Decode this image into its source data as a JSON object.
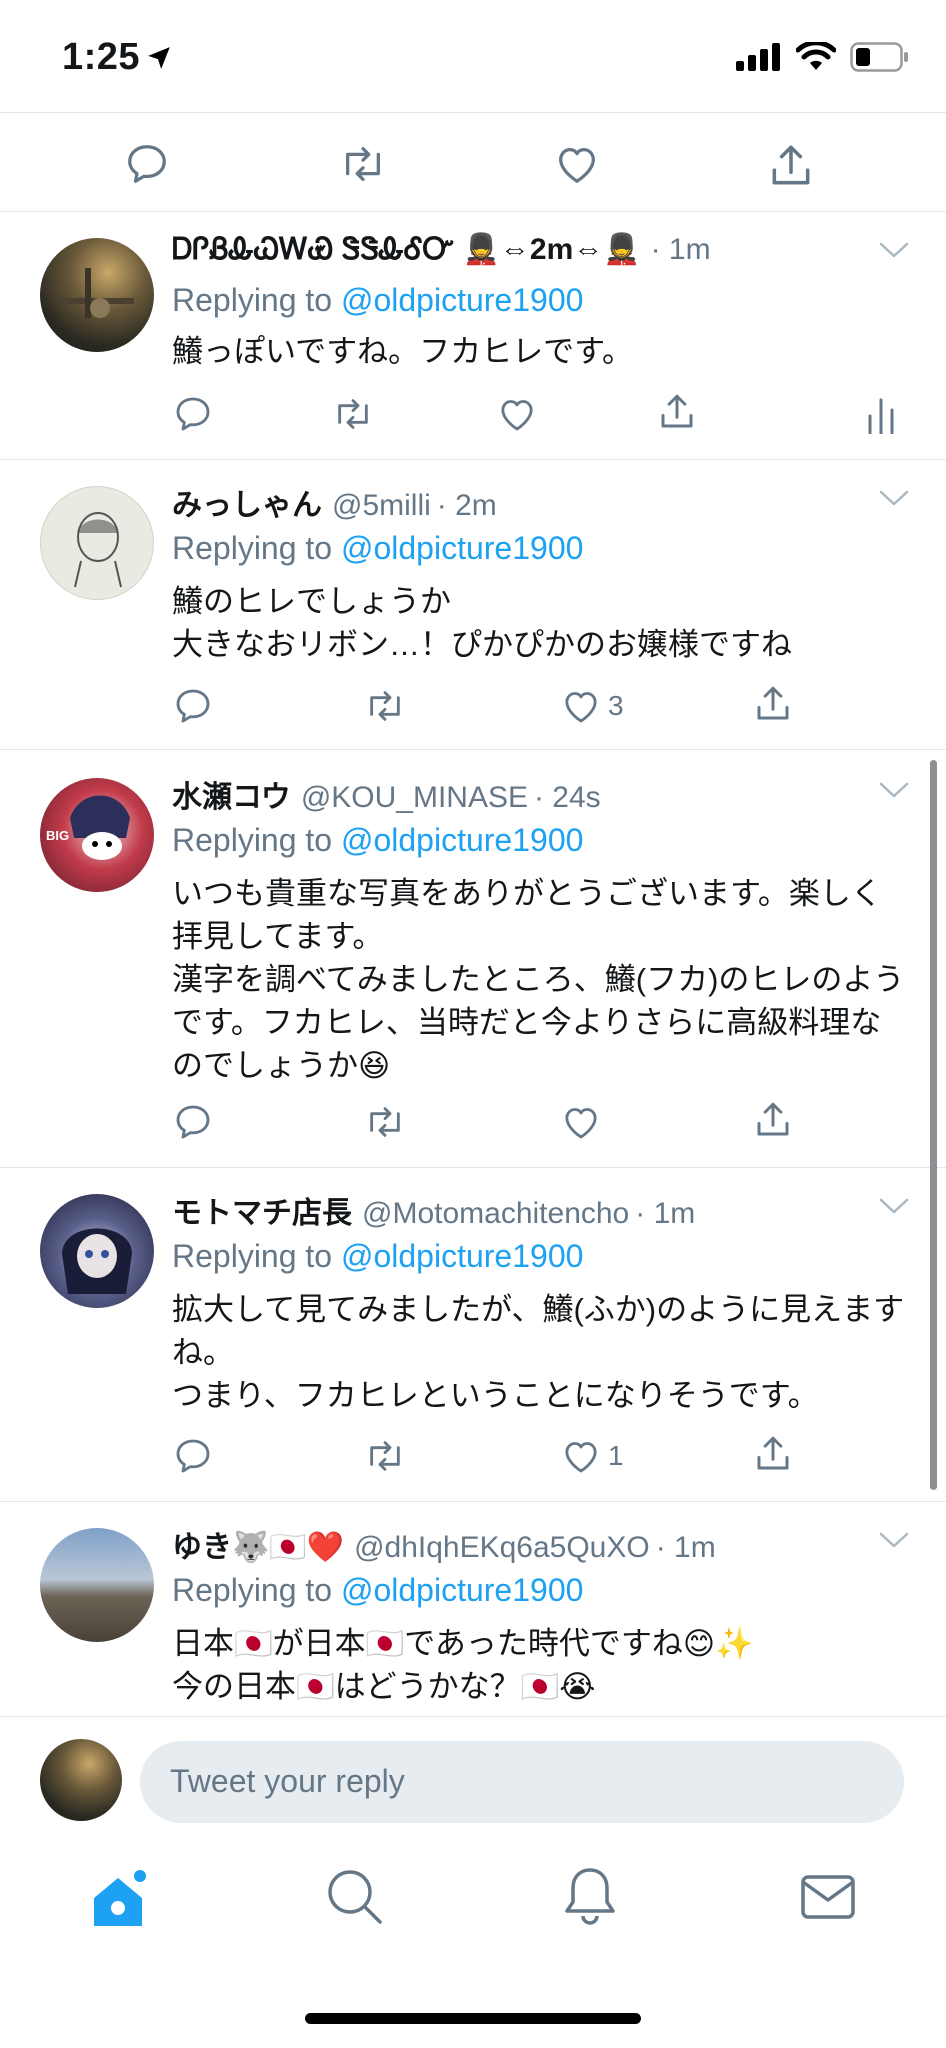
{
  "status_bar": {
    "time": "1:25"
  },
  "tweets": [
    {
      "name": "ᎠᎵᏰᎲᏇᎳᏯ ᏕᏕᎲᎴᏅ 💂⇔2m⇔💂",
      "handle": "",
      "time": "· 1m",
      "replying_label": "Replying to ",
      "replying_to": "@oldpicture1900",
      "lines": [
        "鱶っぽいですね。フカヒレです。"
      ],
      "likes": ""
    },
    {
      "name": "みっしゃん",
      "handle": "@5milli",
      "time": "· 2m",
      "replying_label": "Replying to ",
      "replying_to": "@oldpicture1900",
      "lines": [
        "鱶のヒレでしょうか",
        "大きなおリボン…！ぴかぴかのお嬢様ですね"
      ],
      "likes": "3"
    },
    {
      "name": "水瀬コウ",
      "handle": "@KOU_MINASE",
      "time": "· 24s",
      "replying_label": "Replying to ",
      "replying_to": "@oldpicture1900",
      "lines": [
        "いつも貴重な写真をありがとうございます。楽しく",
        "拝見してます。",
        "漢字を調べてみましたところ、鱶(フカ)のヒレのよう",
        "です。フカヒレ、当時だと今よりさらに高級料理な",
        "のでしょうか😆"
      ],
      "likes": ""
    },
    {
      "name": "モトマチ店長",
      "handle": "@Motomachitencho",
      "time": "· 1m",
      "replying_label": "Replying to ",
      "replying_to": "@oldpicture1900",
      "lines": [
        "拡大して見てみましたが、鱶(ふか)のように見えます",
        "ね。",
        "つまり、フカヒレということになりそうです。"
      ],
      "likes": "1"
    },
    {
      "name": "ゆき🐺🇯🇵❤️",
      "handle": "@dhIqhEKq6a5QuXO",
      "time": "· 1m",
      "replying_label": "Replying to ",
      "replying_to": "@oldpicture1900",
      "lines": [
        "日本🇯🇵が日本🇯🇵であった時代ですね😊✨",
        "今の日本🇯🇵はどうかな？🇯🇵😭"
      ],
      "likes": ""
    }
  ],
  "composer": {
    "placeholder": "Tweet your reply"
  },
  "tabbar": {
    "items": [
      "home-icon",
      "search-icon",
      "notifications-icon",
      "messages-icon"
    ]
  },
  "colors": {
    "accent": "#1da1f2",
    "icon_gray": "#657786",
    "divider": "#e1e8ed",
    "reply_box": "#e6ecf0"
  }
}
